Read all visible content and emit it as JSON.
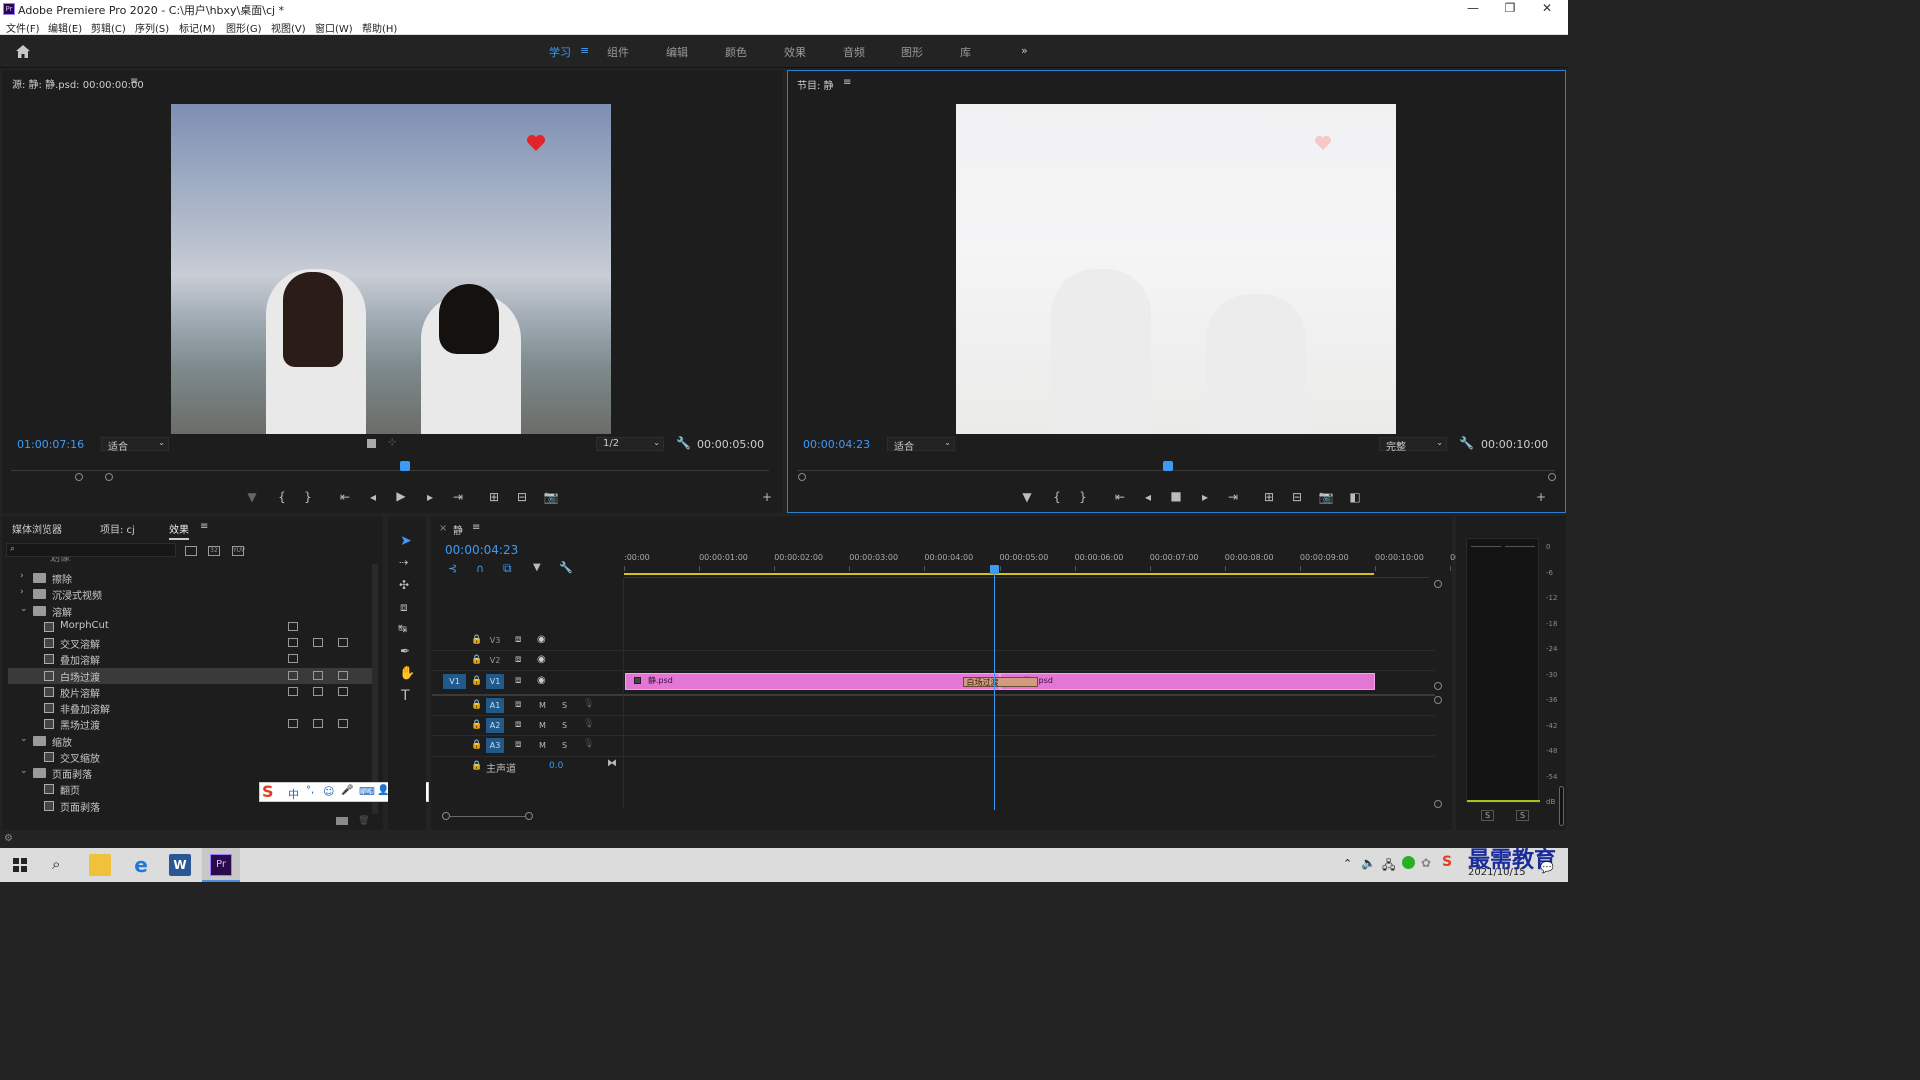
{
  "window": {
    "title": "Adobe Premiere Pro 2020 - C:\\用户\\hbxy\\桌面\\cj *",
    "min_label": "—",
    "max_label": "❐",
    "close_label": "✕"
  },
  "menu": [
    "文件(F)",
    "编辑(E)",
    "剪辑(C)",
    "序列(S)",
    "标记(M)",
    "图形(G)",
    "视图(V)",
    "窗口(W)",
    "帮助(H)"
  ],
  "workspaces": {
    "items": [
      "学习",
      "组件",
      "编辑",
      "颜色",
      "效果",
      "音频",
      "图形",
      "库"
    ],
    "active": "学习",
    "more": "»"
  },
  "source_monitor": {
    "title": "源: 静: 静.psd: 00:00:00:00",
    "timecode": "01:00:07:16",
    "fit": "适合",
    "resolution": "1/2",
    "duration": "00:00:05:00",
    "playhead_fraction": 0.52
  },
  "program_monitor": {
    "title": "节目: 静",
    "timecode": "00:00:04:23",
    "fit": "适合",
    "quality": "完整",
    "duration": "00:00:10:00",
    "playhead_fraction": 0.49
  },
  "effects_panel": {
    "tabs": [
      "媒体浏览器",
      "项目: cj",
      "效果"
    ],
    "active_tab": "效果",
    "cutoff_label": "划像",
    "tree": [
      {
        "label": "擦除",
        "type": "folder",
        "expanded": false,
        "indent": 0
      },
      {
        "label": "沉浸式视频",
        "type": "folder",
        "expanded": false,
        "indent": 0
      },
      {
        "label": "溶解",
        "type": "folder",
        "expanded": true,
        "indent": 0
      },
      {
        "label": "MorphCut",
        "type": "effect",
        "indent": 1,
        "badges": 1
      },
      {
        "label": "交叉溶解",
        "type": "effect",
        "indent": 1,
        "badges": 3
      },
      {
        "label": "叠加溶解",
        "type": "effect",
        "indent": 1,
        "badges": 1
      },
      {
        "label": "白场过渡",
        "type": "effect",
        "indent": 1,
        "badges": 3,
        "selected": true
      },
      {
        "label": "胶片溶解",
        "type": "effect",
        "indent": 1,
        "badges": 3
      },
      {
        "label": "非叠加溶解",
        "type": "effect",
        "indent": 1,
        "badges": 0
      },
      {
        "label": "黑场过渡",
        "type": "effect",
        "indent": 1,
        "badges": 3
      },
      {
        "label": "缩放",
        "type": "folder",
        "expanded": true,
        "indent": 0
      },
      {
        "label": "交叉缩放",
        "type": "effect",
        "indent": 1,
        "badges": 0
      },
      {
        "label": "页面剥落",
        "type": "folder",
        "expanded": true,
        "indent": 0
      },
      {
        "label": "翻页",
        "type": "effect",
        "indent": 1,
        "badges": 0
      },
      {
        "label": "页面剥落",
        "type": "effect",
        "indent": 1,
        "badges": 0
      }
    ]
  },
  "ime_bar": {
    "items": [
      "S",
      "中",
      "°,",
      "☺",
      "🎤",
      "⌨",
      "👤",
      "👕",
      "▦"
    ]
  },
  "timeline": {
    "sequence_name": "静",
    "timecode": "00:00:04:23",
    "ruler_labels": [
      ":00:00",
      "00:00:01:00",
      "00:00:02:00",
      "00:00:03:00",
      "00:00:04:00",
      "00:00:05:00",
      "00:00:06:00",
      "00:00:07:00",
      "00:00:08:00",
      "00:00:09:00",
      "00:00:10:00",
      "00"
    ],
    "video_tracks": [
      "V3",
      "V2",
      "V1"
    ],
    "audio_tracks": [
      "A1",
      "A2",
      "A3"
    ],
    "source_patch": "V1",
    "audio_m": "M",
    "audio_s": "S",
    "master_label": "主声道",
    "master_value": "0.0",
    "clips": [
      {
        "name": "静.psd",
        "track": "V1",
        "start_sec": 0.0,
        "end_sec": 5.0
      },
      {
        "name": "静2.psd",
        "track": "V1",
        "start_sec": 5.0,
        "end_sec": 10.0
      }
    ],
    "transition": {
      "name": "白场过渡",
      "start_sec": 4.5,
      "end_sec": 5.5
    },
    "playhead_sec": 4.92,
    "duration_sec": 10.0
  },
  "audio_meter": {
    "ticks": [
      "0",
      "-6",
      "-12",
      "-18",
      "-24",
      "-30",
      "-36",
      "-42",
      "-48",
      "-54",
      "dB"
    ],
    "solo_labels": [
      "S",
      "S"
    ]
  },
  "taskbar": {
    "date": "2021/10/15",
    "watermark": "最需教育",
    "apps": [
      "windows-start",
      "search",
      "file-explorer",
      "edge",
      "word",
      "premiere"
    ],
    "active_app": "premiere"
  },
  "colors": {
    "accent": "#3d9bf7",
    "clip": "#e377d6",
    "transition": "#d19c7e",
    "panel_bg": "#1d1d1d",
    "app_bg": "#232323"
  }
}
